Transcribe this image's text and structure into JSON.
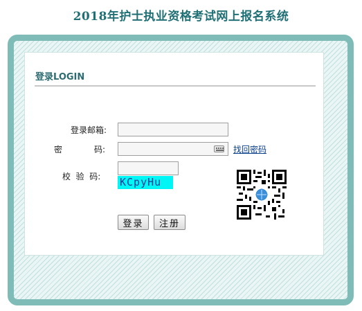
{
  "page": {
    "title": "2018年护士执业资格考试网上报名系统"
  },
  "panel": {
    "heading": "登录LOGIN"
  },
  "form": {
    "email_label": "登录邮箱:",
    "email_value": "",
    "password_label_left": "密",
    "password_label_right": "码:",
    "password_value": "",
    "recover_link": "找回密码",
    "verify_label": "校  验  码:",
    "verify_value": "",
    "captcha_text": "KCpyHu"
  },
  "buttons": {
    "login": "登录",
    "register": "注册"
  },
  "icons": {
    "keyboard": "keyboard-icon",
    "qr": "qr-code-icon"
  },
  "colors": {
    "title": "#1f6f74",
    "frame": "#7fbcb7",
    "captcha_bg": "#00f5f5",
    "link": "#0a3f8c"
  }
}
